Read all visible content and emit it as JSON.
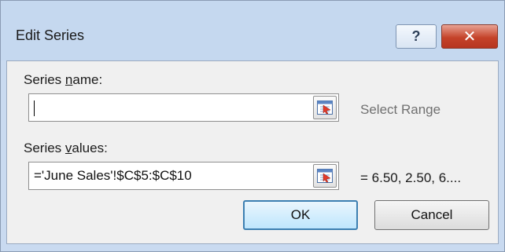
{
  "dialog": {
    "title": "Edit Series",
    "help_symbol": "?",
    "close_symbol": "✕"
  },
  "series_name": {
    "label_prefix": "Series ",
    "label_access_key": "n",
    "label_suffix": "ame:",
    "value": "",
    "side_text": "Select Range"
  },
  "series_values": {
    "label_prefix": "Series ",
    "label_access_key": "v",
    "label_suffix": "alues:",
    "value": "='June Sales'!$C$5:$C$10",
    "side_text": "= 6.50, 2.50, 6...."
  },
  "buttons": {
    "ok": "OK",
    "cancel": "Cancel"
  }
}
